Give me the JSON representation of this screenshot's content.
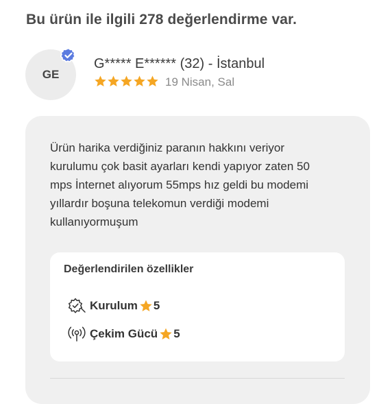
{
  "summary": {
    "heading": "Bu ürün ile ilgili 278 değerlendirme var."
  },
  "review": {
    "avatar_initials": "GE",
    "verified_color": "#5b7be0",
    "reviewer": "G***** E****** (32) - İstanbul",
    "rating": 5,
    "rating_max": 5,
    "star_color": "#f5a623",
    "date": "19 Nisan, Sal",
    "text": "Ürün harika verdiğiniz paranın hakkını veriyor\nkurulumu çok basit ayarları kendi yapıyor zaten 50\nmps İnternet alıyorum 55mps hız  geldi bu modemi\nyıllardır boşuna telekomun verdiği modemi\nkullanıyormuşum",
    "features": {
      "title": "Değerlendirilen özellikler",
      "items": [
        {
          "icon": "gear-check-icon",
          "label": "Kurulum",
          "score": "5"
        },
        {
          "icon": "wireless-signal-icon",
          "label": "Çekim Gücü",
          "score": "5"
        }
      ]
    }
  }
}
